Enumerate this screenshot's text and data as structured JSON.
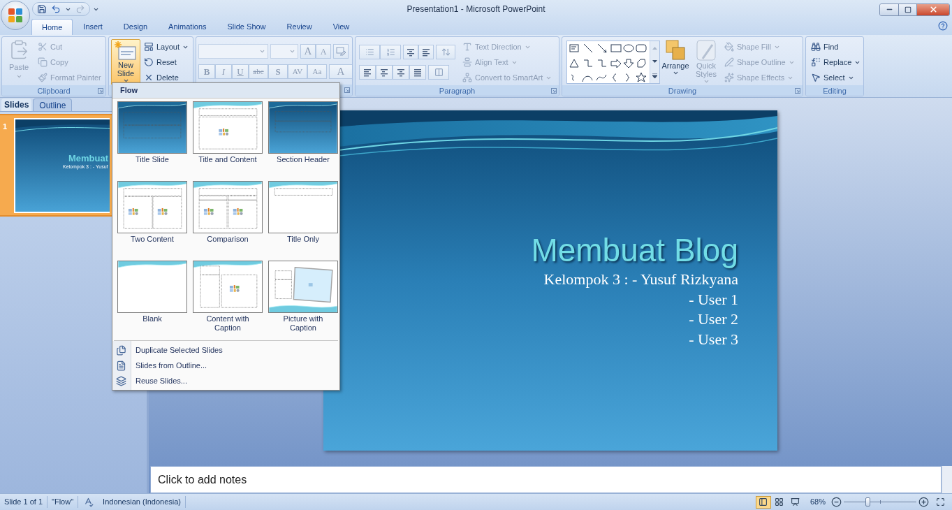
{
  "window": {
    "title": "Presentation1 - Microsoft PowerPoint"
  },
  "tabs": [
    {
      "label": "Home",
      "selected": true
    },
    {
      "label": "Insert",
      "selected": false
    },
    {
      "label": "Design",
      "selected": false
    },
    {
      "label": "Animations",
      "selected": false
    },
    {
      "label": "Slide Show",
      "selected": false
    },
    {
      "label": "Review",
      "selected": false
    },
    {
      "label": "View",
      "selected": false
    }
  ],
  "clipboard": {
    "label": "Clipboard",
    "paste": {
      "label": "Paste",
      "disabled": true
    },
    "commands": [
      {
        "label": "Cut",
        "kind": "cut",
        "disabled": true
      },
      {
        "label": "Copy",
        "kind": "copy",
        "disabled": true
      },
      {
        "label": "Format Painter",
        "kind": "painter",
        "disabled": true
      }
    ]
  },
  "slides_group": {
    "new_slide": {
      "lines": [
        "New",
        "Slide"
      ],
      "expanded": true
    },
    "commands": [
      {
        "label": "Layout",
        "kind": "layout",
        "dropdown": true
      },
      {
        "label": "Reset",
        "kind": "reset",
        "dropdown": false
      },
      {
        "label": "Delete",
        "kind": "delete",
        "dropdown": false
      }
    ]
  },
  "font": {
    "disabled": true,
    "size_buttons": [
      "A",
      "A"
    ],
    "format_buttons": [
      "B",
      "I",
      "U",
      "abc",
      "S",
      "AV",
      "Aa"
    ],
    "color_button": "A"
  },
  "paragraph": {
    "label": "Paragraph",
    "disabled": true,
    "commands": [
      {
        "label": "Text Direction",
        "kind": "direction"
      },
      {
        "label": "Align Text",
        "kind": "align"
      },
      {
        "label": "Convert to SmartArt",
        "kind": "smartart"
      }
    ]
  },
  "drawing": {
    "label": "Drawing",
    "large": [
      {
        "lines": [
          "Arrange"
        ],
        "kind": "arrange",
        "disabled": false
      },
      {
        "lines": [
          "Quick",
          "Styles"
        ],
        "kind": "styles",
        "disabled": true
      }
    ],
    "commands": [
      {
        "label": "Shape Fill",
        "kind": "fill",
        "disabled": true
      },
      {
        "label": "Shape Outline",
        "kind": "outline",
        "disabled": true
      },
      {
        "label": "Shape Effects",
        "kind": "effects",
        "disabled": true
      }
    ]
  },
  "editing": {
    "label": "Editing",
    "commands": [
      {
        "label": "Find",
        "kind": "find",
        "dropdown": false
      },
      {
        "label": "Replace",
        "kind": "replace",
        "dropdown": true
      },
      {
        "label": "Select",
        "kind": "select",
        "dropdown": true
      }
    ]
  },
  "layout_menu": {
    "heading": "Flow",
    "layouts": [
      {
        "label": "Title Slide",
        "kind": "title"
      },
      {
        "label": "Title and Content",
        "kind": "title_content"
      },
      {
        "label": "Section Header",
        "kind": "section"
      },
      {
        "label": "Two Content",
        "kind": "two_content"
      },
      {
        "label": "Comparison",
        "kind": "comparison"
      },
      {
        "label": "Title Only",
        "kind": "title_only"
      },
      {
        "label": "Blank",
        "kind": "blank"
      },
      {
        "label": "Content with Caption",
        "kind": "content_caption"
      },
      {
        "label": "Picture with Caption",
        "kind": "picture_caption"
      }
    ],
    "commands": [
      {
        "label": "Duplicate Selected Slides",
        "kind": "duplicate"
      },
      {
        "label": "Slides from Outline...",
        "kind": "outline"
      },
      {
        "label": "Reuse Slides...",
        "kind": "reuse"
      }
    ]
  },
  "slide_panel": {
    "tabs": [
      {
        "label": "Slides",
        "selected": true
      },
      {
        "label": "Outline",
        "selected": false
      }
    ],
    "thumbnails": [
      {
        "number": "1",
        "selected": true,
        "title": "Membuat",
        "subtitle": "Kelompok 3 : - Yusuf"
      }
    ]
  },
  "slide": {
    "title": "Membuat Blog",
    "lines": [
      "Kelompok 3 : - Yusuf Rizkyana",
      "- User 1",
      "- User 2",
      "- User 3"
    ]
  },
  "notes": {
    "placeholder": "Click to add notes"
  },
  "status_bar": {
    "items": [
      "Slide 1 of 1",
      "\"Flow\"",
      "Indonesian (Indonesia)"
    ],
    "views": [
      {
        "kind": "normal",
        "selected": true
      },
      {
        "kind": "sorter",
        "selected": false
      },
      {
        "kind": "show",
        "selected": false
      }
    ],
    "zoom": "68%",
    "zoom_slider": {
      "level": 0.33
    }
  }
}
